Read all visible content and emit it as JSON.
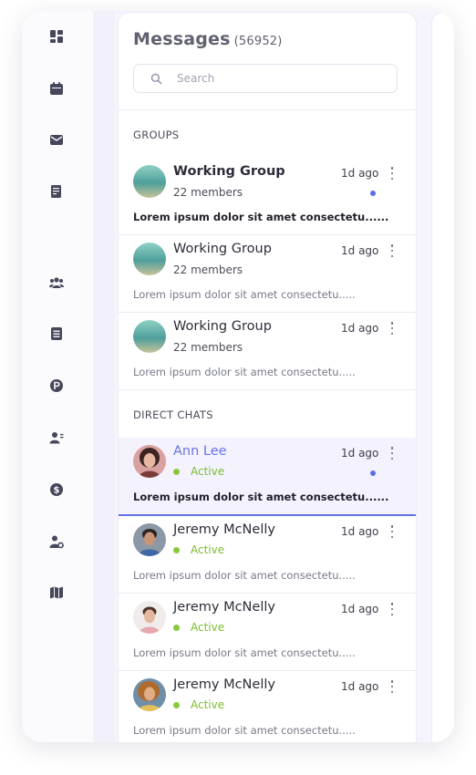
{
  "rail": {
    "icons": [
      "dashboard-icon",
      "calendar-icon",
      "mail-icon",
      "invoice-icon",
      "team-icon",
      "document-icon",
      "parking-icon",
      "contacts-icon",
      "dollar-icon",
      "user-settings-icon",
      "map-icon"
    ]
  },
  "messages": {
    "title": "Messages",
    "count": "(56952)",
    "search_placeholder": "Search"
  },
  "groups": {
    "heading": "GROUPS",
    "items": [
      {
        "name": "Working Group",
        "sub": "22 members",
        "time": "1d ago",
        "preview": "Lorem ipsum dolor sit amet consectetu......",
        "unread": true
      },
      {
        "name": "Working Group",
        "sub": "22 members",
        "time": "1d ago",
        "preview": "Lorem ipsum dolor sit amet consectetu.....",
        "unread": false
      },
      {
        "name": "Working Group",
        "sub": "22 members",
        "time": "1d ago",
        "preview": "Lorem ipsum dolor sit amet consectetu.....",
        "unread": false
      }
    ]
  },
  "direct": {
    "heading": "DIRECT CHATS",
    "items": [
      {
        "name": "Ann Lee",
        "status": "Active",
        "time": "1d ago",
        "preview": "Lorem ipsum dolor sit amet consectetu......",
        "unread": true
      },
      {
        "name": "Jeremy McNelly",
        "status": "Active",
        "time": "1d ago",
        "preview": "Lorem ipsum dolor sit amet consectetu.....",
        "unread": false
      },
      {
        "name": "Jeremy McNelly",
        "status": "Active",
        "time": "1d ago",
        "preview": "Lorem ipsum dolor sit amet consectetu.....",
        "unread": false
      },
      {
        "name": "Jeremy McNelly",
        "status": "Active",
        "time": "1d ago",
        "preview": "Lorem ipsum dolor sit amet consectetu.....",
        "unread": false
      }
    ]
  },
  "colors": {
    "accent": "#6a72e4",
    "active_status": "#7dbd2d",
    "unread_dot": "#5a6ee8"
  }
}
